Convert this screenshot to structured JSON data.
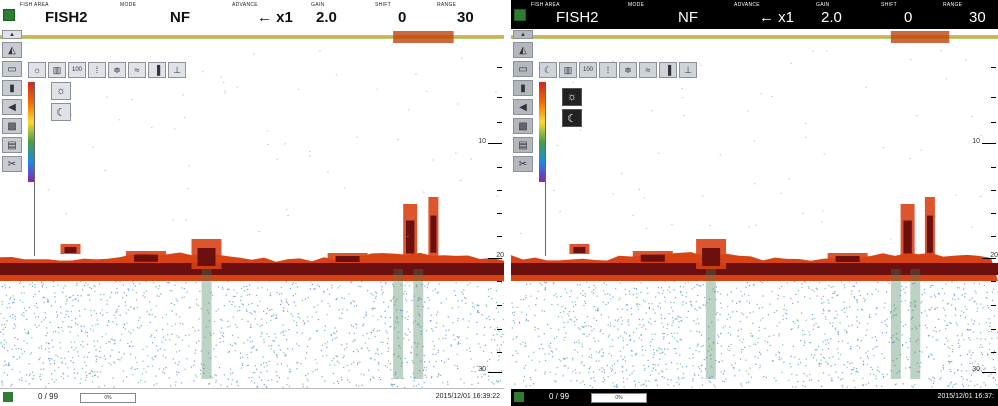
{
  "screens": [
    {
      "theme": "day",
      "header": {
        "fish_area_label": "FISH AREA",
        "fish_area_value": "FISH2",
        "mode_label": "MODE",
        "mode_value": "NF",
        "advance_label": "ADVANCE",
        "advance_value": "← x1",
        "gain_label": "GAIN",
        "gain_value": "2.0",
        "shift_label": "SHIFT",
        "shift_value": "0",
        "range_label": "RANGE",
        "range_value": "30"
      },
      "depth_scale": {
        "labels": [
          "10",
          "20",
          "30"
        ]
      },
      "toolbar_icons": [
        "sun-icon",
        "bars-icon",
        "100-icon",
        "dot-grid-icon",
        "minus-grid-icon",
        "wave-icon",
        "bar-icon",
        "tree-icon"
      ],
      "submenu_icons": [
        "sun-icon",
        "moon-icon"
      ],
      "footer": {
        "count": "0 / 99",
        "progress_label": "0%",
        "progress_value": 0,
        "timestamp": "2015/12/01 16:39:22"
      }
    },
    {
      "theme": "night",
      "header": {
        "fish_area_label": "FISH AREA",
        "fish_area_value": "FISH2",
        "mode_label": "MODE",
        "mode_value": "NF",
        "advance_label": "ADVANCE",
        "advance_value": "← x1",
        "gain_label": "GAIN",
        "gain_value": "2.0",
        "shift_label": "SHIFT",
        "shift_value": "0",
        "range_label": "RANGE",
        "range_value": "30"
      },
      "depth_scale": {
        "labels": [
          "10",
          "20",
          "30"
        ]
      },
      "toolbar_icons": [
        "moon-icon",
        "bars-icon",
        "100-icon",
        "dot-grid-icon",
        "minus-grid-icon",
        "wave-icon",
        "bar-icon",
        "tree-icon"
      ],
      "submenu_icons": [
        "sun-icon",
        "moon-icon"
      ],
      "footer": {
        "count": "0 / 99",
        "progress_label": "0%",
        "progress_value": 0,
        "timestamp": "2015/12/01 16:37:"
      }
    }
  ],
  "colors": {
    "seabed": "#6b0f0f",
    "seabed_edge": "#d84315",
    "noise_green": "#4caf8a",
    "noise_blue": "#4a7fd4",
    "accent": "#2e7d32"
  }
}
